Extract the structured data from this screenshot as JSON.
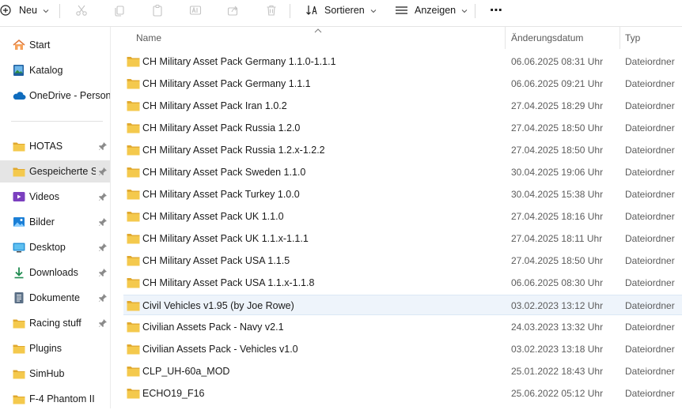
{
  "toolbar": {
    "new_label": "Neu",
    "sort_label": "Sortieren",
    "view_label": "Anzeigen",
    "more_label": "⋯"
  },
  "sidebar": {
    "top_items": [
      {
        "label": "Start",
        "icon": "home-icon"
      },
      {
        "label": "Katalog",
        "icon": "gallery-icon"
      },
      {
        "label": "OneDrive - Persona",
        "icon": "cloud-icon"
      }
    ],
    "pinned_items": [
      {
        "label": "HOTAS",
        "icon": "folder-icon",
        "pinned": true
      },
      {
        "label": "Gespeicherte Sp",
        "icon": "folder-icon",
        "pinned": true,
        "selected": true
      },
      {
        "label": "Videos",
        "icon": "videos-icon",
        "pinned": true
      },
      {
        "label": "Bilder",
        "icon": "pictures-icon",
        "pinned": true
      },
      {
        "label": "Desktop",
        "icon": "desktop-icon",
        "pinned": true
      },
      {
        "label": "Downloads",
        "icon": "download-icon",
        "pinned": true
      },
      {
        "label": "Dokumente",
        "icon": "documents-icon",
        "pinned": true
      },
      {
        "label": "Racing stuff",
        "icon": "folder-icon",
        "pinned": true
      },
      {
        "label": "Plugins",
        "icon": "folder-icon",
        "pinned": false
      },
      {
        "label": "SimHub",
        "icon": "folder-icon",
        "pinned": false
      },
      {
        "label": "F-4 Phantom II",
        "icon": "folder-icon",
        "pinned": false
      }
    ]
  },
  "list": {
    "columns": {
      "name": "Name",
      "date": "Änderungsdatum",
      "type": "Typ"
    },
    "rows": [
      {
        "name": "CH Military Asset Pack Germany 1.1.0-1.1.1",
        "date": "06.06.2025 08:31 Uhr",
        "type": "Dateiordner"
      },
      {
        "name": "CH Military Asset Pack Germany 1.1.1",
        "date": "06.06.2025 09:21 Uhr",
        "type": "Dateiordner"
      },
      {
        "name": "CH Military Asset Pack Iran 1.0.2",
        "date": "27.04.2025 18:29 Uhr",
        "type": "Dateiordner"
      },
      {
        "name": "CH Military Asset Pack Russia 1.2.0",
        "date": "27.04.2025 18:50 Uhr",
        "type": "Dateiordner"
      },
      {
        "name": "CH Military Asset Pack Russia 1.2.x-1.2.2",
        "date": "27.04.2025 18:50 Uhr",
        "type": "Dateiordner"
      },
      {
        "name": "CH Military Asset Pack Sweden 1.1.0",
        "date": "30.04.2025 19:06 Uhr",
        "type": "Dateiordner"
      },
      {
        "name": "CH Military Asset Pack Turkey 1.0.0",
        "date": "30.04.2025 15:38 Uhr",
        "type": "Dateiordner"
      },
      {
        "name": "CH Military Asset Pack UK 1.1.0",
        "date": "27.04.2025 18:16 Uhr",
        "type": "Dateiordner"
      },
      {
        "name": "CH Military Asset Pack UK 1.1.x-1.1.1",
        "date": "27.04.2025 18:11 Uhr",
        "type": "Dateiordner"
      },
      {
        "name": "CH Military Asset Pack USA 1.1.5",
        "date": "27.04.2025 18:50 Uhr",
        "type": "Dateiordner"
      },
      {
        "name": "CH Military Asset Pack USA 1.1.x-1.1.8",
        "date": "06.06.2025 08:30 Uhr",
        "type": "Dateiordner"
      },
      {
        "name": "Civil Vehicles v1.95 (by Joe Rowe)",
        "date": "03.02.2023 13:12 Uhr",
        "type": "Dateiordner",
        "selected": true
      },
      {
        "name": "Civilian Assets Pack - Navy v2.1",
        "date": "24.03.2023 13:32 Uhr",
        "type": "Dateiordner"
      },
      {
        "name": "Civilian Assets Pack - Vehicles v1.0",
        "date": "03.02.2023 13:18 Uhr",
        "type": "Dateiordner"
      },
      {
        "name": "CLP_UH-60a_MOD",
        "date": "25.01.2022 18:43 Uhr",
        "type": "Dateiordner"
      },
      {
        "name": "ECHO19_F16",
        "date": "25.06.2022 05:12 Uhr",
        "type": "Dateiordner"
      }
    ]
  },
  "colors": {
    "folder": "#f4c94d",
    "folder_dark": "#e0a82e",
    "accent": "#0067c0",
    "selected_row": "#eef4fb",
    "selected_nav": "#e5e5e5"
  }
}
